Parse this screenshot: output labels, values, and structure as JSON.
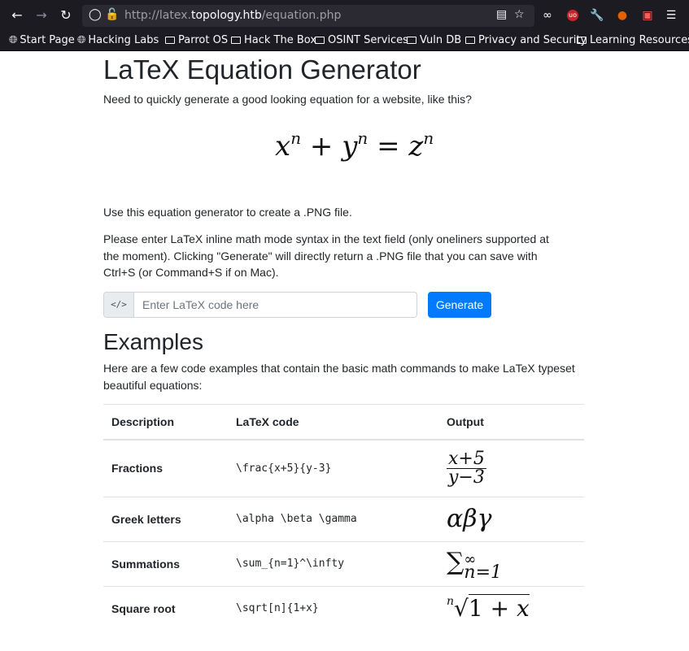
{
  "browser": {
    "url_prefix": "http://latex.",
    "url_host": "topology.htb",
    "url_path": "/equation.php",
    "bookmarks": [
      "Start Page",
      "Hacking Labs",
      "Parrot OS",
      "Hack The Box",
      "OSINT Services",
      "Vuln DB",
      "Privacy and Security",
      "Learning Resources"
    ]
  },
  "page": {
    "title": "LaTeX Equation Generator",
    "intro": "Need to quickly generate a good looking equation for a website, like this?",
    "usage": "Use this equation generator to create a .PNG file.",
    "instructions": "Please enter LaTeX inline math mode syntax in the text field (only oneliners supported at the moment). Clicking \"Generate\" will directly return a .PNG file that you can save with Ctrl+S (or Command+S if on Mac).",
    "input_prefix": "</>",
    "input_placeholder": "Enter LaTeX code here",
    "generate_label": "Generate",
    "examples_title": "Examples",
    "examples_intro": "Here are a few code examples that contain the basic math commands to make LaTeX typeset beautiful equations:"
  },
  "table": {
    "headers": [
      "Description",
      "LaTeX code",
      "Output"
    ],
    "rows": [
      {
        "description": "Fractions",
        "code": "\\frac{x+5}{y-3}"
      },
      {
        "description": "Greek letters",
        "code": "\\alpha \\beta \\gamma"
      },
      {
        "description": "Summations",
        "code": "\\sum_{n=1}^\\infty"
      },
      {
        "description": "Square root",
        "code": "\\sqrt[n]{1+x}"
      }
    ]
  }
}
